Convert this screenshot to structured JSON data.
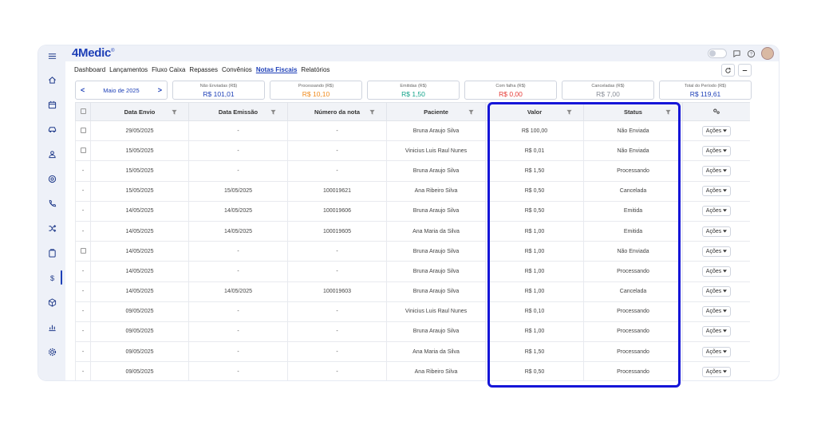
{
  "app": {
    "logo": "4Medic",
    "logo_mark": "®"
  },
  "nav": [
    "Dashboard",
    "Lançamentos",
    "Fluxo Caixa",
    "Repasses",
    "Convênios",
    "Notas Fiscais",
    "Relatórios"
  ],
  "nav_active_index": 5,
  "month": {
    "label": "Maio de 2025",
    "prev": "<",
    "next": ">"
  },
  "cards": [
    {
      "label": "Não Enviadas (R$)",
      "value": "R$ 101,01",
      "color": "#1d3fb7"
    },
    {
      "label": "Processando (R$)",
      "value": "R$ 10,10",
      "color": "#f08a1c"
    },
    {
      "label": "Emitidas (R$)",
      "value": "R$ 1,50",
      "color": "#14a38b"
    },
    {
      "label": "Com falha (R$)",
      "value": "R$ 0,00",
      "color": "#e53935"
    },
    {
      "label": "Canceladas (R$)",
      "value": "R$ 7,00",
      "color": "#8a8f99"
    },
    {
      "label": "Total do Período (R$)",
      "value": "R$ 119,61",
      "color": "#1d3fb7"
    }
  ],
  "table": {
    "columns": [
      "Data Envio",
      "Data Emissão",
      "Número da nota",
      "Paciente",
      "Valor",
      "Status"
    ],
    "action_label": "Ações",
    "rows": [
      {
        "sel": "box",
        "envio": "29/05/2025",
        "emissao": "-",
        "numero": "-",
        "paciente": "Bruna Araujo Silva",
        "valor": "R$ 100,00",
        "status": "Não Enviada"
      },
      {
        "sel": "box",
        "envio": "15/05/2025",
        "emissao": "-",
        "numero": "-",
        "paciente": "Vinicius Luis Raul Nunes",
        "valor": "R$ 0,01",
        "status": "Não Enviada"
      },
      {
        "sel": "-",
        "envio": "15/05/2025",
        "emissao": "-",
        "numero": "-",
        "paciente": "Bruna Araujo Silva",
        "valor": "R$ 1,50",
        "status": "Processando"
      },
      {
        "sel": "-",
        "envio": "15/05/2025",
        "emissao": "15/05/2025",
        "numero": "100019621",
        "paciente": "Ana Ribeiro Silva",
        "valor": "R$ 0,50",
        "status": "Cancelada"
      },
      {
        "sel": "-",
        "envio": "14/05/2025",
        "emissao": "14/05/2025",
        "numero": "100019606",
        "paciente": "Bruna Araujo Silva",
        "valor": "R$ 0,50",
        "status": "Emitida"
      },
      {
        "sel": "-",
        "envio": "14/05/2025",
        "emissao": "14/05/2025",
        "numero": "100019605",
        "paciente": "Ana Maria da Silva",
        "valor": "R$ 1,00",
        "status": "Emitida"
      },
      {
        "sel": "box",
        "envio": "14/05/2025",
        "emissao": "-",
        "numero": "-",
        "paciente": "Bruna Araujo Silva",
        "valor": "R$ 1,00",
        "status": "Não Enviada"
      },
      {
        "sel": "-",
        "envio": "14/05/2025",
        "emissao": "-",
        "numero": "-",
        "paciente": "Bruna Araujo Silva",
        "valor": "R$ 1,00",
        "status": "Processando"
      },
      {
        "sel": "-",
        "envio": "14/05/2025",
        "emissao": "14/05/2025",
        "numero": "100019603",
        "paciente": "Bruna Araujo Silva",
        "valor": "R$ 1,00",
        "status": "Cancelada"
      },
      {
        "sel": "-",
        "envio": "09/05/2025",
        "emissao": "-",
        "numero": "-",
        "paciente": "Vinicius Luis Raul Nunes",
        "valor": "R$ 0,10",
        "status": "Processando"
      },
      {
        "sel": "-",
        "envio": "09/05/2025",
        "emissao": "-",
        "numero": "-",
        "paciente": "Bruna Araujo Silva",
        "valor": "R$ 1,00",
        "status": "Processando"
      },
      {
        "sel": "-",
        "envio": "09/05/2025",
        "emissao": "-",
        "numero": "-",
        "paciente": "Ana Maria da Silva",
        "valor": "R$ 1,50",
        "status": "Processando"
      },
      {
        "sel": "-",
        "envio": "09/05/2025",
        "emissao": "-",
        "numero": "-",
        "paciente": "Ana Ribeiro Silva",
        "valor": "R$ 0,50",
        "status": "Processando"
      }
    ]
  },
  "sidebar_icons": [
    "menu-icon",
    "home-icon",
    "calendar-icon",
    "car-icon",
    "user-icon",
    "at-icon",
    "phone-icon",
    "shuffle-icon",
    "clipboard-icon",
    "dollar-icon",
    "box-icon",
    "chart-icon",
    "settings-icon"
  ],
  "sidebar_active": "dollar-icon",
  "highlight_color": "#1515d8"
}
